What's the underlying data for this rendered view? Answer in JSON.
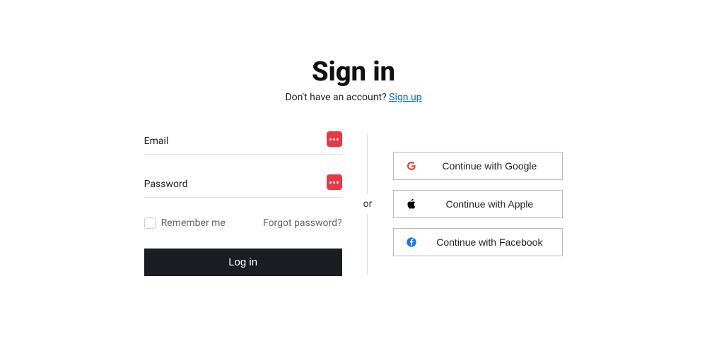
{
  "header": {
    "title": "Sign in",
    "subtitle_prefix": "Don't have an account? ",
    "signup_link": "Sign up"
  },
  "form": {
    "email_label": "Email",
    "email_value": "",
    "password_label": "Password",
    "password_value": "",
    "remember_label": "Remember me",
    "forgot_label": "Forgot password?",
    "login_label": "Log in"
  },
  "divider": {
    "or_label": "or"
  },
  "social": {
    "google_label": "Continue with Google",
    "apple_label": "Continue with Apple",
    "facebook_label": "Continue with Facebook"
  }
}
